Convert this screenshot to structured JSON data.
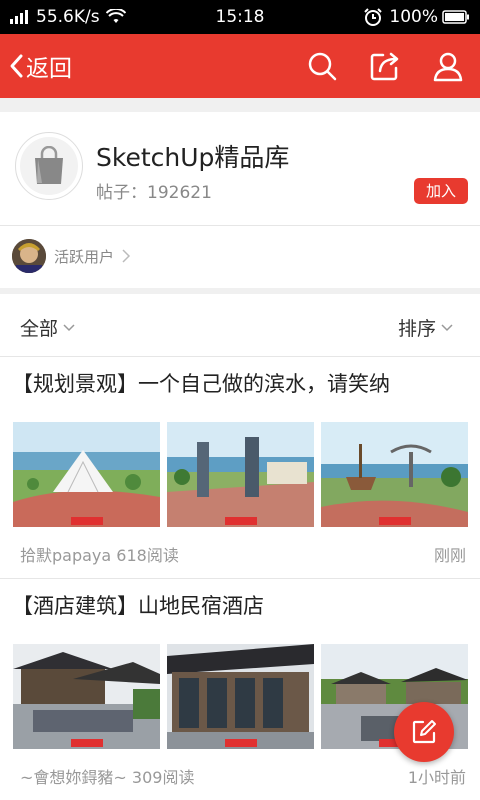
{
  "status_bar": {
    "speed": "55.6K/s",
    "time": "15:18",
    "battery": "100%"
  },
  "app_bar": {
    "back_label": "返回"
  },
  "forum": {
    "title": "SketchUp精品库",
    "posts_label": "帖子：",
    "posts_count": "192621",
    "join_label": "加入",
    "active_users_label": "活跃用户"
  },
  "filter": {
    "all_label": "全部",
    "sort_label": "排序"
  },
  "posts": [
    {
      "title": "【规划景观】一个自己做的滨水，请笑纳",
      "author": "拾默papaya",
      "reads": "618阅读",
      "time": "刚刚"
    },
    {
      "title": "【酒店建筑】山地民宿酒店",
      "author": "~會想妳鍀豬~",
      "reads": "309阅读",
      "time": "1小时前"
    }
  ],
  "colors": {
    "accent": "#e83a2f",
    "status_bar": "#000000"
  },
  "icons": [
    "wifi-icon",
    "alarm-icon",
    "battery-icon",
    "back-arrow-icon",
    "search-icon",
    "share-icon",
    "user-icon",
    "shopping-bag-icon",
    "chevron-down-icon",
    "chevron-right-icon",
    "edit-icon"
  ]
}
